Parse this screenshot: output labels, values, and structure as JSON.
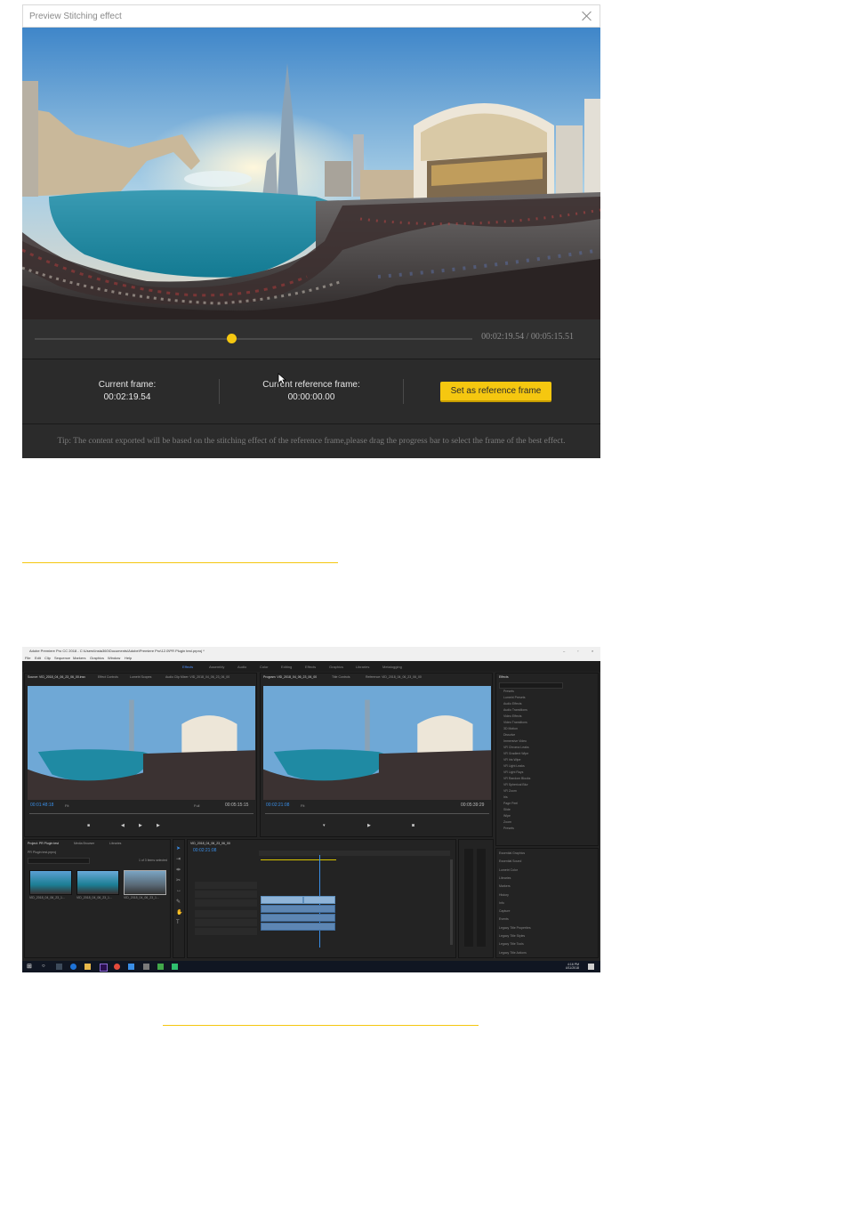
{
  "dialog": {
    "title": "Preview Stitching effect",
    "close_icon": "close-icon",
    "timecode": "00:02:19.54 / 00:05:15.51",
    "progress": 0.45,
    "current_frame_label": "Current frame:",
    "current_frame_value": "00:02:19.54",
    "reference_frame_label": "Current reference frame:",
    "reference_frame_value": "00:00:00.00",
    "set_reference_button": "Set as reference frame",
    "tip": "Tip: The content exported will be based on the stitching effect of the reference frame,please drag the progress bar to select the frame of the best effect."
  },
  "colors": {
    "accent": "#f5c710",
    "dialog_bg": "#2b2b2b",
    "premiere_blue": "#3a8ee6"
  },
  "premiere": {
    "title": "Adobe Premiere Pro CC 2018 - C:\\Users\\Insta360\\Documents\\Adobe\\Premiere Pro\\12.0\\PR Plugin test.prproj *",
    "menu": [
      "File",
      "Edit",
      "Clip",
      "Sequence",
      "Markers",
      "Graphics",
      "Window",
      "Help"
    ],
    "workspaces": [
      "Effects",
      "Assembly",
      "Audio",
      "Color",
      "Editing",
      "Effects",
      "Graphics",
      "Libraries",
      "Metalogging"
    ],
    "source_tab": "Source: VID_2018_04_06_23_06_00.insv",
    "source_tabs_other": [
      "Effect Controls",
      "Lumetri Scopes",
      "Audio Clip Mixer: VID_2018_04_06_23_06_00"
    ],
    "program_tab": "Program: VID_2018_04_06_23_06_00",
    "program_tabs_other": [
      "Title Controls",
      "Reference: VID_2018_04_06_23_06_00"
    ],
    "source_timecode": "00:01:48:18",
    "source_fit": "Fit",
    "source_duration": "00:05:15:15",
    "program_timecode": "00:02:21:08",
    "program_fit": "Fit",
    "program_duration": "00:05:39:29",
    "quality": "Full",
    "project_tab": "Project: PR Plugin test",
    "project_tabs_other": [
      "Media Browser",
      "Libraries"
    ],
    "project_file": "PR Plugin test.prproj",
    "project_selected": "1 of 3 items selected",
    "bin_items": [
      "VID_2018_04_06_23_1...",
      "VID_2018_04_06_23_1...",
      "VID_2018_04_06_23_1..."
    ],
    "bin_durations": [
      "5:15:15",
      "5:28:25",
      "5:38:28"
    ],
    "timeline_tab": "VID_2018_04_06_23_06_00",
    "timeline_timecode": "00:02:21:08",
    "effects_tab": "Effects",
    "effects_tree": [
      "Presets",
      "Lumetri Presets",
      "Audio Effects",
      "Audio Transitions",
      "Video Effects",
      "Video Transitions",
      "3D Motion",
      "Dissolve",
      "Immersive Video",
      "VR Chroma Leaks",
      "VR Gradient Wipe",
      "VR Iris Wipe",
      "VR Light Leaks",
      "VR Light Rays",
      "VR Random Blocks",
      "VR Spherical Blur",
      "VR Zoom",
      "Iris",
      "Page Peel",
      "Slide",
      "Wipe",
      "Zoom",
      "Presets"
    ],
    "side_panels": [
      "Essential Graphics",
      "Essential Sound",
      "Lumetri Color",
      "Libraries",
      "Markers",
      "History",
      "Info",
      "Capture",
      "Events",
      "Legacy Title Properties",
      "Legacy Title Styles",
      "Legacy Title Tools",
      "Legacy Title Actions"
    ],
    "clock_time": "4:16 PM",
    "clock_date": "4/11/2018"
  }
}
